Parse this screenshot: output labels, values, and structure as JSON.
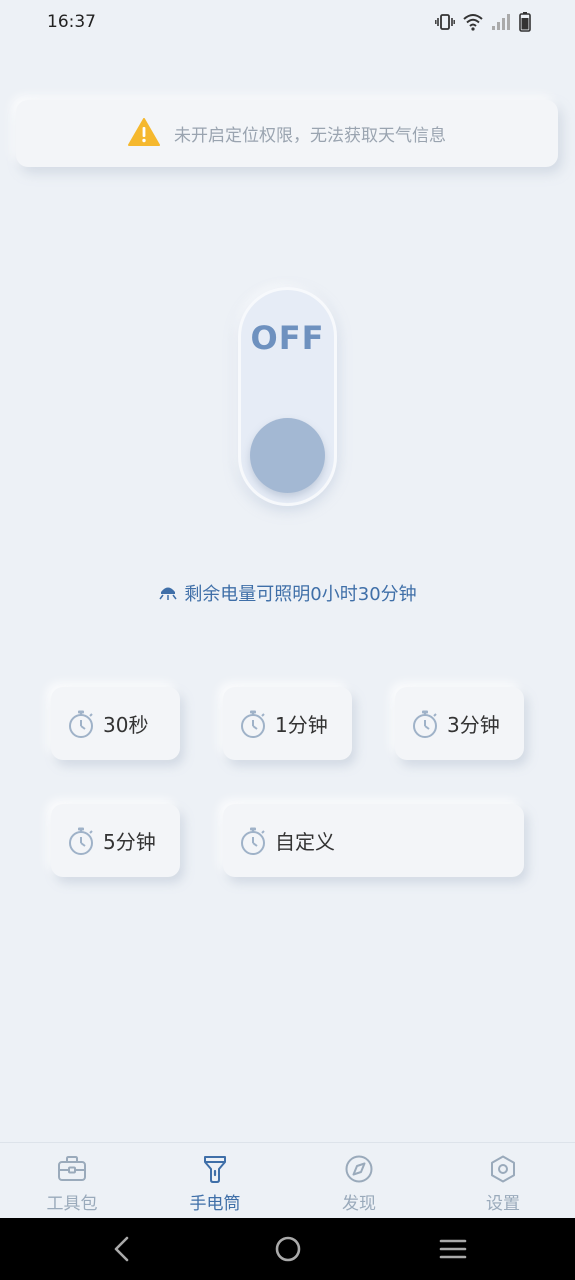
{
  "status_bar": {
    "time": "16:37",
    "icons": [
      "vibrate-icon",
      "wifi-icon",
      "signal-icon",
      "battery-icon"
    ]
  },
  "warning": {
    "icon": "warning-icon",
    "text": "未开启定位权限，无法获取天气信息",
    "icon_color": "#f5b82e"
  },
  "switch": {
    "state_label": "OFF",
    "knob_color": "#a3b8d3",
    "label_color": "#6e91bf"
  },
  "battery_info": {
    "icon": "flashlight-bulb-icon",
    "text": "剩余电量可照明0小时30分钟"
  },
  "timers": [
    {
      "label": "30秒",
      "icon": "stopwatch-icon"
    },
    {
      "label": "1分钟",
      "icon": "stopwatch-icon"
    },
    {
      "label": "3分钟",
      "icon": "stopwatch-icon"
    },
    {
      "label": "5分钟",
      "icon": "stopwatch-icon"
    },
    {
      "label": "自定义",
      "icon": "stopwatch-icon"
    }
  ],
  "bottom_nav": {
    "items": [
      {
        "label": "工具包",
        "icon": "toolbox-icon",
        "active": false
      },
      {
        "label": "手电筒",
        "icon": "flashlight-icon",
        "active": true
      },
      {
        "label": "发现",
        "icon": "compass-icon",
        "active": false
      },
      {
        "label": "设置",
        "icon": "settings-hexagon-icon",
        "active": false
      }
    ],
    "active_color": "#3f6fa8",
    "inactive_color": "#9aaabb"
  },
  "system_nav": [
    "back-icon",
    "home-icon",
    "menu-icon"
  ]
}
